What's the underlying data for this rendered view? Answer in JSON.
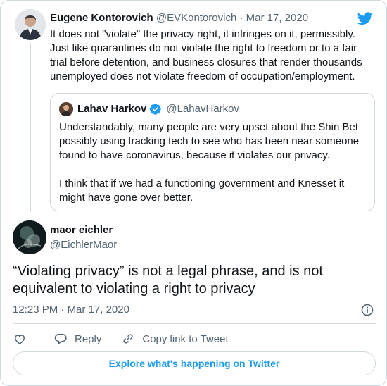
{
  "parent_tweet": {
    "display_name": "Eugene Kontorovich",
    "handle": "@EVKontorovich",
    "separator": "·",
    "date": "Mar 17, 2020",
    "text": "It does not \"violate\" the privacy right, it infringes on it, permissibly. Just like quarantines do not violate the right to freedom or to a fair trial before detention, and business closures that render thousands unemployed does not violate freedom of occupation/employment."
  },
  "quoted_tweet": {
    "display_name": "Lahav Harkov",
    "handle": "@LahavHarkov",
    "paragraphs": [
      "Understandably, many people are very upset about the Shin Bet possibly using tracking tech to see who has been near someone found to have coronavirus, because it violates our privacy.",
      "I think that if we had a functioning government and Knesset it might have gone over better."
    ]
  },
  "main_tweet": {
    "display_name": "maor eichler",
    "handle": "@EichlerMaor",
    "text": "“Violating privacy” is not a legal phrase, and is not equivalent to violating a right to privacy",
    "time": "12:23 PM",
    "separator": "·",
    "date": "Mar 17, 2020"
  },
  "actions": {
    "reply_label": "Reply",
    "copy_link_label": "Copy link to Tweet"
  },
  "explore_label": "Explore what's happening on Twitter",
  "icons": {
    "brand": "twitter-bird-icon",
    "verified": "verified-badge-icon",
    "like": "heart-icon",
    "reply": "speech-bubble-icon",
    "copy_link": "link-icon",
    "info": "info-icon"
  },
  "colors": {
    "accent": "#1d9bf0",
    "text": "#0f1419",
    "muted": "#536471",
    "border": "#cfd9de"
  }
}
